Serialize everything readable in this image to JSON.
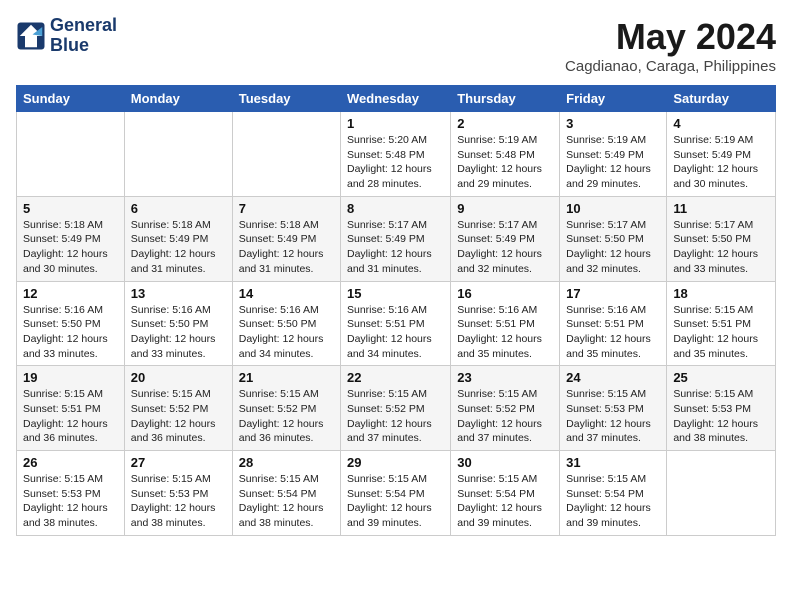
{
  "header": {
    "logo_line1": "General",
    "logo_line2": "Blue",
    "month_title": "May 2024",
    "location": "Cagdianao, Caraga, Philippines"
  },
  "weekdays": [
    "Sunday",
    "Monday",
    "Tuesday",
    "Wednesday",
    "Thursday",
    "Friday",
    "Saturday"
  ],
  "weeks": [
    [
      {
        "day": "",
        "info": ""
      },
      {
        "day": "",
        "info": ""
      },
      {
        "day": "",
        "info": ""
      },
      {
        "day": "1",
        "info": "Sunrise: 5:20 AM\nSunset: 5:48 PM\nDaylight: 12 hours\nand 28 minutes."
      },
      {
        "day": "2",
        "info": "Sunrise: 5:19 AM\nSunset: 5:48 PM\nDaylight: 12 hours\nand 29 minutes."
      },
      {
        "day": "3",
        "info": "Sunrise: 5:19 AM\nSunset: 5:49 PM\nDaylight: 12 hours\nand 29 minutes."
      },
      {
        "day": "4",
        "info": "Sunrise: 5:19 AM\nSunset: 5:49 PM\nDaylight: 12 hours\nand 30 minutes."
      }
    ],
    [
      {
        "day": "5",
        "info": "Sunrise: 5:18 AM\nSunset: 5:49 PM\nDaylight: 12 hours\nand 30 minutes."
      },
      {
        "day": "6",
        "info": "Sunrise: 5:18 AM\nSunset: 5:49 PM\nDaylight: 12 hours\nand 31 minutes."
      },
      {
        "day": "7",
        "info": "Sunrise: 5:18 AM\nSunset: 5:49 PM\nDaylight: 12 hours\nand 31 minutes."
      },
      {
        "day": "8",
        "info": "Sunrise: 5:17 AM\nSunset: 5:49 PM\nDaylight: 12 hours\nand 31 minutes."
      },
      {
        "day": "9",
        "info": "Sunrise: 5:17 AM\nSunset: 5:49 PM\nDaylight: 12 hours\nand 32 minutes."
      },
      {
        "day": "10",
        "info": "Sunrise: 5:17 AM\nSunset: 5:50 PM\nDaylight: 12 hours\nand 32 minutes."
      },
      {
        "day": "11",
        "info": "Sunrise: 5:17 AM\nSunset: 5:50 PM\nDaylight: 12 hours\nand 33 minutes."
      }
    ],
    [
      {
        "day": "12",
        "info": "Sunrise: 5:16 AM\nSunset: 5:50 PM\nDaylight: 12 hours\nand 33 minutes."
      },
      {
        "day": "13",
        "info": "Sunrise: 5:16 AM\nSunset: 5:50 PM\nDaylight: 12 hours\nand 33 minutes."
      },
      {
        "day": "14",
        "info": "Sunrise: 5:16 AM\nSunset: 5:50 PM\nDaylight: 12 hours\nand 34 minutes."
      },
      {
        "day": "15",
        "info": "Sunrise: 5:16 AM\nSunset: 5:51 PM\nDaylight: 12 hours\nand 34 minutes."
      },
      {
        "day": "16",
        "info": "Sunrise: 5:16 AM\nSunset: 5:51 PM\nDaylight: 12 hours\nand 35 minutes."
      },
      {
        "day": "17",
        "info": "Sunrise: 5:16 AM\nSunset: 5:51 PM\nDaylight: 12 hours\nand 35 minutes."
      },
      {
        "day": "18",
        "info": "Sunrise: 5:15 AM\nSunset: 5:51 PM\nDaylight: 12 hours\nand 35 minutes."
      }
    ],
    [
      {
        "day": "19",
        "info": "Sunrise: 5:15 AM\nSunset: 5:51 PM\nDaylight: 12 hours\nand 36 minutes."
      },
      {
        "day": "20",
        "info": "Sunrise: 5:15 AM\nSunset: 5:52 PM\nDaylight: 12 hours\nand 36 minutes."
      },
      {
        "day": "21",
        "info": "Sunrise: 5:15 AM\nSunset: 5:52 PM\nDaylight: 12 hours\nand 36 minutes."
      },
      {
        "day": "22",
        "info": "Sunrise: 5:15 AM\nSunset: 5:52 PM\nDaylight: 12 hours\nand 37 minutes."
      },
      {
        "day": "23",
        "info": "Sunrise: 5:15 AM\nSunset: 5:52 PM\nDaylight: 12 hours\nand 37 minutes."
      },
      {
        "day": "24",
        "info": "Sunrise: 5:15 AM\nSunset: 5:53 PM\nDaylight: 12 hours\nand 37 minutes."
      },
      {
        "day": "25",
        "info": "Sunrise: 5:15 AM\nSunset: 5:53 PM\nDaylight: 12 hours\nand 38 minutes."
      }
    ],
    [
      {
        "day": "26",
        "info": "Sunrise: 5:15 AM\nSunset: 5:53 PM\nDaylight: 12 hours\nand 38 minutes."
      },
      {
        "day": "27",
        "info": "Sunrise: 5:15 AM\nSunset: 5:53 PM\nDaylight: 12 hours\nand 38 minutes."
      },
      {
        "day": "28",
        "info": "Sunrise: 5:15 AM\nSunset: 5:54 PM\nDaylight: 12 hours\nand 38 minutes."
      },
      {
        "day": "29",
        "info": "Sunrise: 5:15 AM\nSunset: 5:54 PM\nDaylight: 12 hours\nand 39 minutes."
      },
      {
        "day": "30",
        "info": "Sunrise: 5:15 AM\nSunset: 5:54 PM\nDaylight: 12 hours\nand 39 minutes."
      },
      {
        "day": "31",
        "info": "Sunrise: 5:15 AM\nSunset: 5:54 PM\nDaylight: 12 hours\nand 39 minutes."
      },
      {
        "day": "",
        "info": ""
      }
    ]
  ]
}
